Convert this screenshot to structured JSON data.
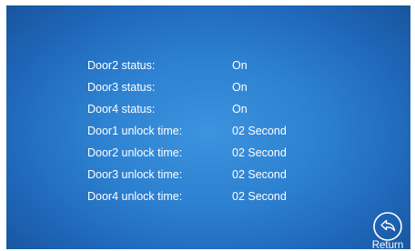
{
  "settings": [
    {
      "label": "Door2 status:",
      "value": "On"
    },
    {
      "label": "Door3 status:",
      "value": "On"
    },
    {
      "label": "Door4 status:",
      "value": "On"
    },
    {
      "label": "Door1 unlock time:",
      "value": "02 Second"
    },
    {
      "label": "Door2 unlock time:",
      "value": "02 Second"
    },
    {
      "label": "Door3 unlock time:",
      "value": "02 Second"
    },
    {
      "label": "Door4 unlock time:",
      "value": "02 Second"
    }
  ],
  "return_button": {
    "label": "Return",
    "icon": "return-arrow-icon"
  },
  "colors": {
    "background_center": "#3c93de",
    "background_edge": "#175299",
    "text": "#ffffff"
  }
}
